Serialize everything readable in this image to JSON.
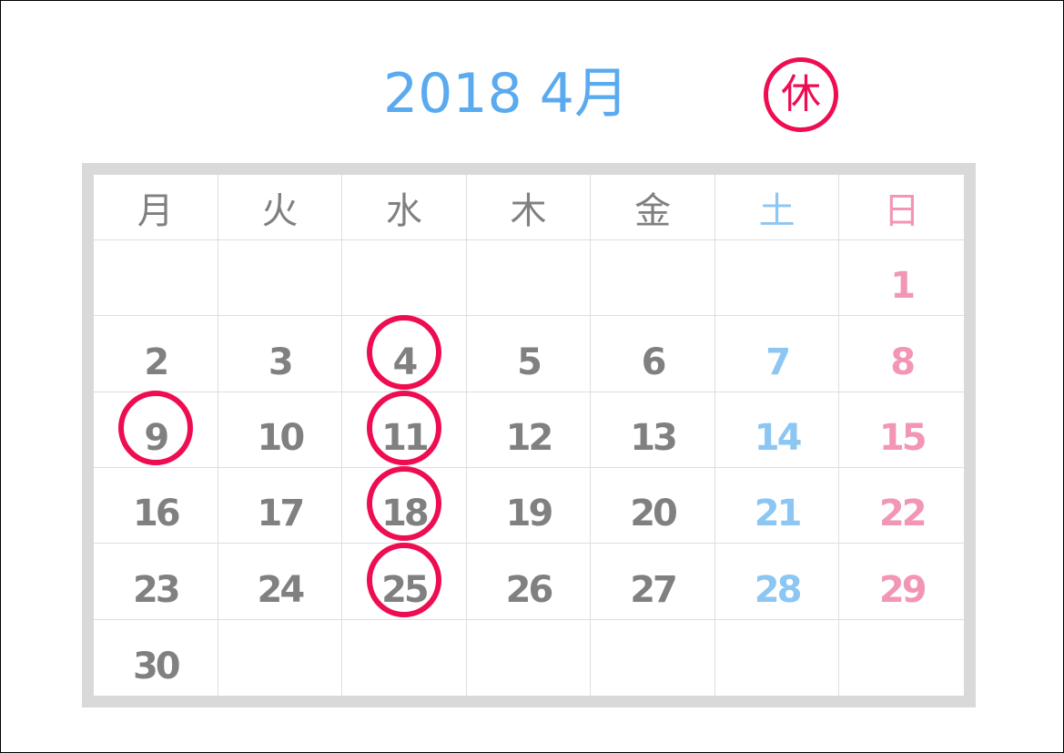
{
  "calendar": {
    "year": "2018",
    "month_label": "2018 4月",
    "closed_symbol": "休",
    "closed_color": "#ee0d50",
    "weekday_headers": [
      "月",
      "火",
      "水",
      "木",
      "金",
      "土",
      "日"
    ],
    "weeks": [
      [
        "",
        "",
        "",
        "",
        "",
        "",
        "1"
      ],
      [
        "2",
        "3",
        "4",
        "5",
        "6",
        "7",
        "8"
      ],
      [
        "9",
        "10",
        "11",
        "12",
        "13",
        "14",
        "15"
      ],
      [
        "16",
        "17",
        "18",
        "19",
        "20",
        "21",
        "22"
      ],
      [
        "23",
        "24",
        "25",
        "26",
        "27",
        "28",
        "29"
      ],
      [
        "30",
        "",
        "",
        "",
        "",
        "",
        ""
      ]
    ],
    "closed_days": [
      "4",
      "9",
      "11",
      "18",
      "25"
    ],
    "colors": {
      "title": "#5aaaf0",
      "weekday": "#808080",
      "saturday": "#8cc6f2",
      "sunday": "#f395b5",
      "frame": "#d9d9d9"
    }
  }
}
